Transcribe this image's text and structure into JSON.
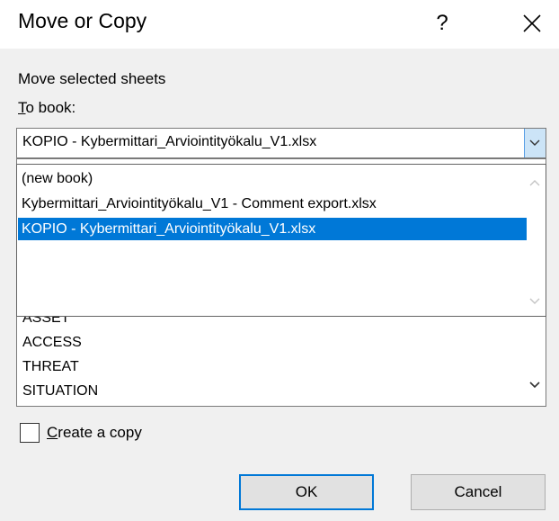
{
  "dialog": {
    "title": "Move or Copy",
    "help_label": "?",
    "close_icon": "close-icon"
  },
  "move_selected_label": "Move selected sheets",
  "to_book": {
    "label_mnemonic": "T",
    "label_rest": "o book:",
    "selected_value": "KOPIO - Kybermittari_Arviointityökalu_V1.xlsx",
    "options": [
      "(new book)",
      "Kybermittari_Arviointityökalu_V1 - Comment export.xlsx",
      "KOPIO - Kybermittari_Arviointityökalu_V1.xlsx"
    ],
    "selected_index": 2
  },
  "sheets": {
    "visible_items": [
      "ASSET",
      "ACCESS",
      "THREAT",
      "SITUATION"
    ]
  },
  "create_copy": {
    "mnemonic": "C",
    "label_rest": "reate a copy",
    "checked": false
  },
  "buttons": {
    "ok_label": "OK",
    "cancel_label": "Cancel"
  },
  "colors": {
    "selection": "#0078d7",
    "dialog_background": "#f0f0f0",
    "combo_arrow_background": "#cce4f7"
  }
}
